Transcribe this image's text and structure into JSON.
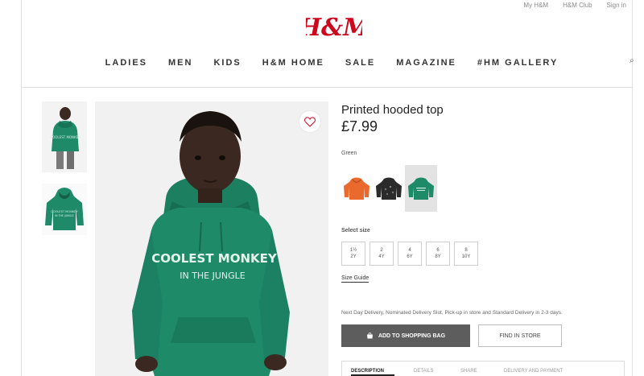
{
  "utility_links": [
    "My H&M",
    "H&M Club",
    "Sign in"
  ],
  "logo_text": "H&M",
  "nav": [
    "LADIES",
    "MEN",
    "KIDS",
    "H&M HOME",
    "SALE",
    "MAGAZINE",
    "#HM GALLERY"
  ],
  "product": {
    "title": "Printed hooded top",
    "price": "£7.99",
    "color_label": "Green",
    "print_text_line1": "COOLEST MONKEY",
    "print_text_line2": "IN THE JUNGLE",
    "size_label": "Select size",
    "sizes": [
      {
        "a": "1½",
        "b": "2Y"
      },
      {
        "a": "2",
        "b": "4Y"
      },
      {
        "a": "4",
        "b": "6Y"
      },
      {
        "a": "6",
        "b": "8Y"
      },
      {
        "a": "8",
        "b": "10Y"
      }
    ],
    "size_guide": "Size Guide",
    "delivery": "Next Day Delivery, Nominated Delivery Slot, Pick-up in store and Standard Delivery in 2-3 days.",
    "add_to_bag": "ADD TO SHOPPING BAG",
    "find_in_store": "FIND IN STORE"
  },
  "tabs": [
    "DESCRIPTION",
    "DETAILS",
    "SHARE",
    "DELIVERY AND PAYMENT"
  ],
  "colors": {
    "brand_red": "#cc071e",
    "hoodie_green": "#1f8a68",
    "swatch_orange": "#e96a2c",
    "swatch_black": "#2b2b2b",
    "button_dark": "#5d5d5d"
  }
}
